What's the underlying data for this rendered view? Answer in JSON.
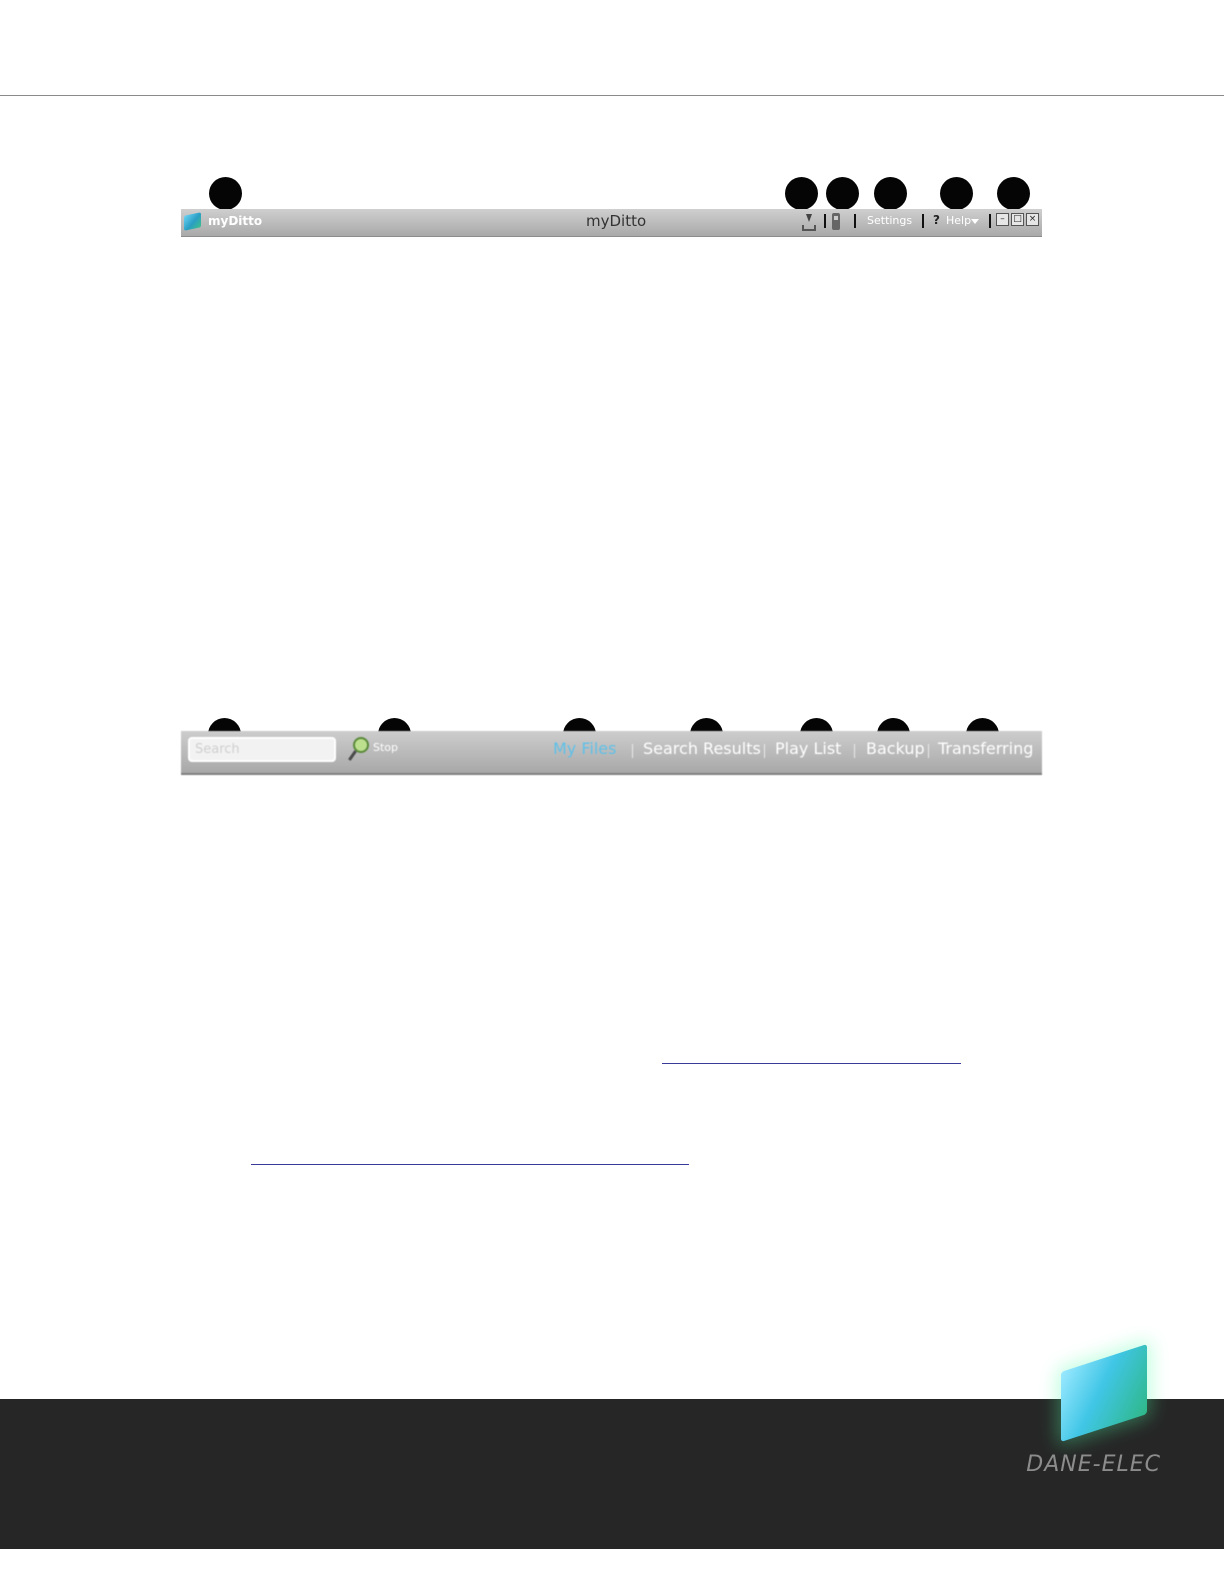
{
  "titlebar": {
    "app_name": "myDitto",
    "window_title": "myDitto",
    "settings_label": "Settings",
    "help_mark": "?",
    "help_label": "Help",
    "minimize_glyph": "–",
    "maximize_glyph": "□",
    "close_glyph": "×"
  },
  "tabbar": {
    "search_placeholder": "Search",
    "stop_label": "Stop",
    "tabs": [
      {
        "label": "My Files"
      },
      {
        "label": "Search Results"
      },
      {
        "label": "Play List"
      },
      {
        "label": "Backup"
      },
      {
        "label": "Transferring"
      }
    ],
    "active_tab": "My Files"
  },
  "footer": {
    "brand": "DANE-ELEC"
  },
  "colors": {
    "active_tab": "#5fc0e8",
    "footer_bg": "#262626",
    "callout": "#050505"
  }
}
